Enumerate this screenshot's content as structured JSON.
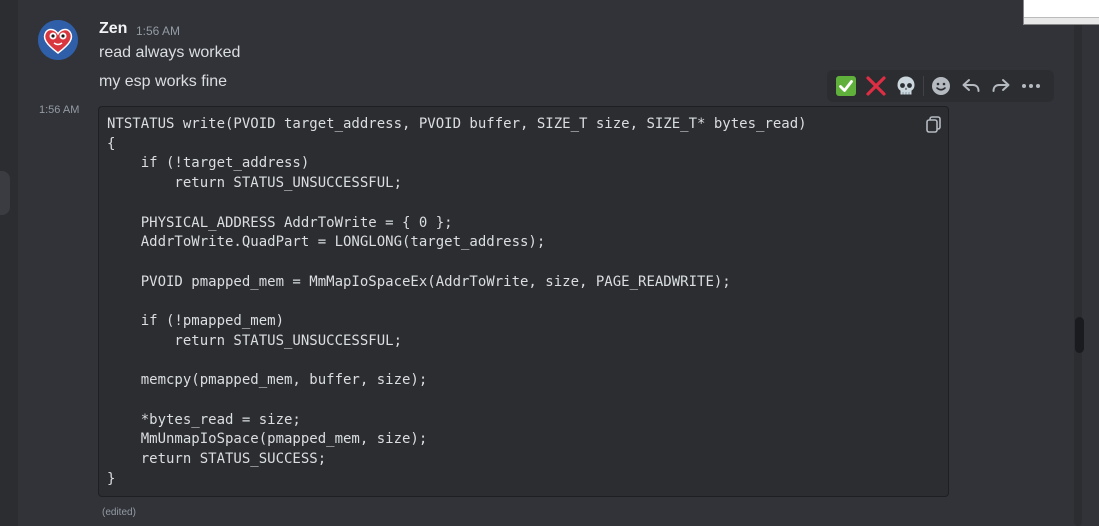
{
  "message": {
    "author": "Zen",
    "timestamp": "1:56 AM",
    "lines": [
      "read always worked",
      "my esp works fine"
    ],
    "code_timestamp": "1:56 AM",
    "code": "NTSTATUS write(PVOID target_address, PVOID buffer, SIZE_T size, SIZE_T* bytes_read)\n{\n    if (!target_address)\n        return STATUS_UNSUCCESSFUL;\n\n    PHYSICAL_ADDRESS AddrToWrite = { 0 };\n    AddrToWrite.QuadPart = LONGLONG(target_address);\n\n    PVOID pmapped_mem = MmMapIoSpaceEx(AddrToWrite, size, PAGE_READWRITE);\n\n    if (!pmapped_mem)\n        return STATUS_UNSUCCESSFUL;\n\n    memcpy(pmapped_mem, buffer, size);\n\n    *bytes_read = size;\n    MmUnmapIoSpace(pmapped_mem, size);\n    return STATUS_SUCCESS;\n}",
    "edited_label": "(edited)"
  },
  "toolbar": {
    "reactions": [
      "check-mark-emoji",
      "cross-mark-emoji",
      "skull-emoji"
    ],
    "actions": [
      "add-reaction-icon",
      "reply-icon",
      "forward-icon",
      "more-icon"
    ]
  },
  "colors": {
    "background": "#313338",
    "code_background": "#2b2d31",
    "text": "#dbdee1",
    "muted": "#949ba4"
  }
}
